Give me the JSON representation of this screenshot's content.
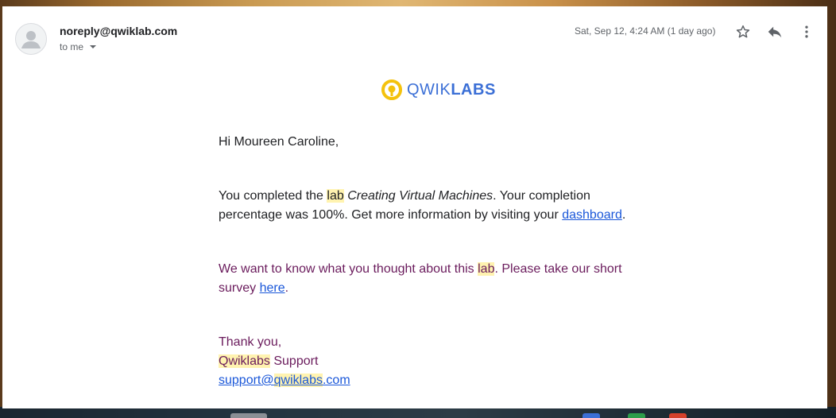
{
  "email": {
    "sender": "noreply@qwiklab.com",
    "recipient_label": "to me",
    "timestamp": "Sat, Sep 12, 4:24 AM (1 day ago)",
    "icons": {
      "avatar": "person-avatar-icon",
      "star": "star-outline-icon",
      "reply": "reply-icon",
      "more": "more-vertical-icon",
      "recipient_toggle": "caret-down-icon"
    }
  },
  "logo": {
    "part_light": "QWIK",
    "part_bold": "LABS",
    "icon": "qwiklabs-logo-icon",
    "ring_color": "#f4c20d",
    "text_color": "#3b6fd6"
  },
  "message": {
    "greeting": "Hi Moureen Caroline,",
    "completed": {
      "before": "You completed the ",
      "highlight": "lab",
      "space": " ",
      "lab_name": "Creating Virtual Machines",
      "after": ". Your completion percentage was 100%. Get more information by visiting your ",
      "link": "dashboard",
      "end": "."
    },
    "survey": {
      "before": "We want to know what you thought about this ",
      "highlight": "lab",
      "after": ". Please take our short survey ",
      "link": "here",
      "end": "."
    },
    "signature": {
      "thanks": "Thank you,",
      "org_highlight": "Qwiklabs",
      "org_rest": " Support",
      "email_part1": "support@",
      "email_highlight": "qwiklabs",
      "email_part2": ".com"
    }
  },
  "colors": {
    "accent_link": "#1a57d9",
    "visited_text": "#6a1b5c",
    "highlight": "#fff3b0"
  }
}
